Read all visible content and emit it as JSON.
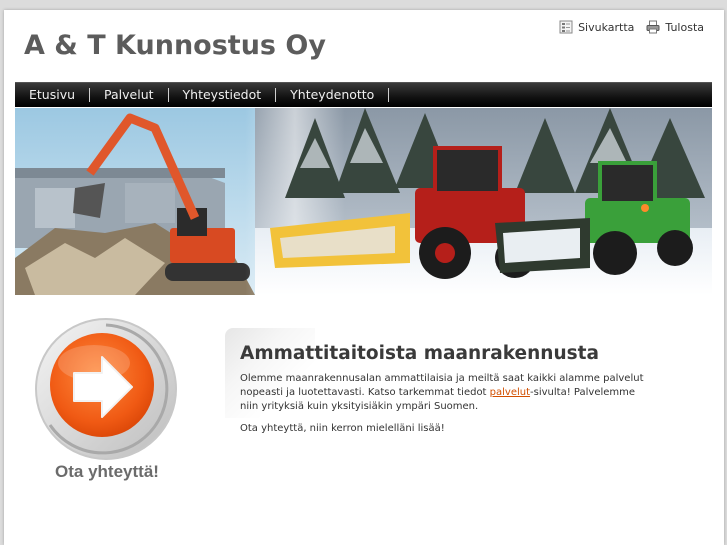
{
  "site": {
    "title": "A & T Kunnostus Oy"
  },
  "toplinks": [
    {
      "label": "Sivukartta",
      "icon": "sitemap-icon"
    },
    {
      "label": "Tulosta",
      "icon": "printer-icon"
    }
  ],
  "nav": [
    {
      "label": "Etusivu"
    },
    {
      "label": "Palvelut"
    },
    {
      "label": "Yhteystiedot"
    },
    {
      "label": "Yhteydenotto"
    }
  ],
  "cta": {
    "label": "Ota yhteyttä!",
    "icon": "arrow-right-icon"
  },
  "content": {
    "heading": "Ammattitaitoista maanrakennusta",
    "p1_before": "Olemme maanrakennusalan ammattilaisia ja meiltä saat kaikki alamme palvelut nopeasti ja luotettavasti. Katso tarkemmat tiedot ",
    "p1_link": "palvelut",
    "p1_after": "-sivulta! Palvelemme niin yrityksiä kuin yksityisiäkin ympäri Suomen.",
    "p2": "Ota yhteyttä, niin kerron mielelläni lisää!"
  },
  "colors": {
    "accent": "#f06a1c",
    "link": "#d24f00",
    "nav_bg": "#111111"
  }
}
